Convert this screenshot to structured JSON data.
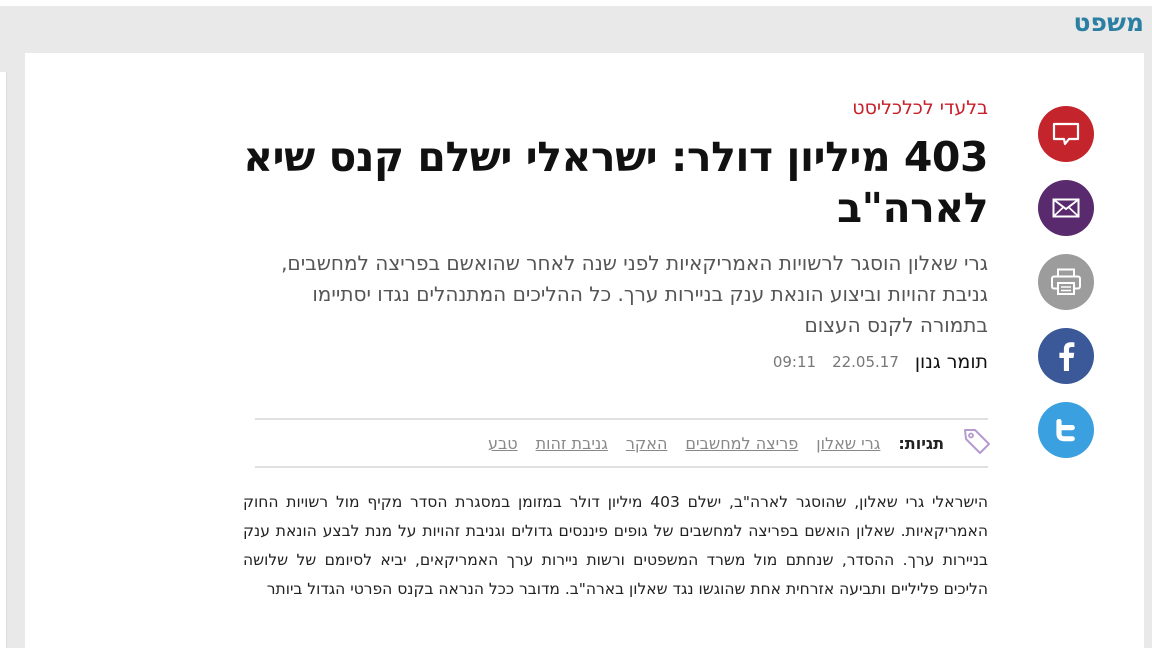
{
  "section": {
    "title": "משפט"
  },
  "share": {
    "comments_icon": "comment-bubble-icon",
    "email_icon": "envelope-icon",
    "print_icon": "printer-icon",
    "facebook_icon": "facebook-icon",
    "twitter_icon": "twitter-icon",
    "colors": {
      "comments": "#c4242b",
      "email": "#5a2a6e",
      "print": "#9c9c9c",
      "facebook": "#3b5998",
      "twitter": "#3aa0e0"
    }
  },
  "article": {
    "kicker": "בלעדי לכלכליסט",
    "headline": "403 מיליון דולר: ישראלי ישלם קנס שיא לארה\"ב",
    "subtitle": "גרי שאלון הוסגר לרשויות האמריקאיות לפני שנה לאחר שהואשם בפריצה למחשבים, גניבת זהויות וביצוע הונאת ענק בניירות ערך. כל ההליכים המתנהלים נגדו יסתיימו בתמורה לקנס העצום",
    "author": "תומר גנון",
    "date": "22.05.17",
    "time": "09:11",
    "body": "הישראלי גרי שאלון, שהוסגר לארה\"ב, ישלם 403 מיליון דולר במזומן במסגרת הסדר מקיף מול רשויות החוק האמריקאיות. שאלון הואשם בפריצה למחשבים של גופים פיננסים גדולים וגניבת זהויות על מנת לבצע הונאת ענק בניירות ערך. ההסדר, שנחתם מול משרד המשפטים ורשות ניירות ערך האמריקאים, יביא לסיומם של שלושה הליכים פליליים ותביעה אזרחית אחת שהוגשו נגד שאלון בארה\"ב. מדובר ככל הנראה בקנס הפרטי הגדול ביותר"
  },
  "tags": {
    "label": "תגיות:",
    "icon": "tag-icon",
    "items": [
      "גרי שאלון",
      "פריצה למחשבים",
      "האקר",
      "גניבת זהות",
      "טבע"
    ]
  }
}
